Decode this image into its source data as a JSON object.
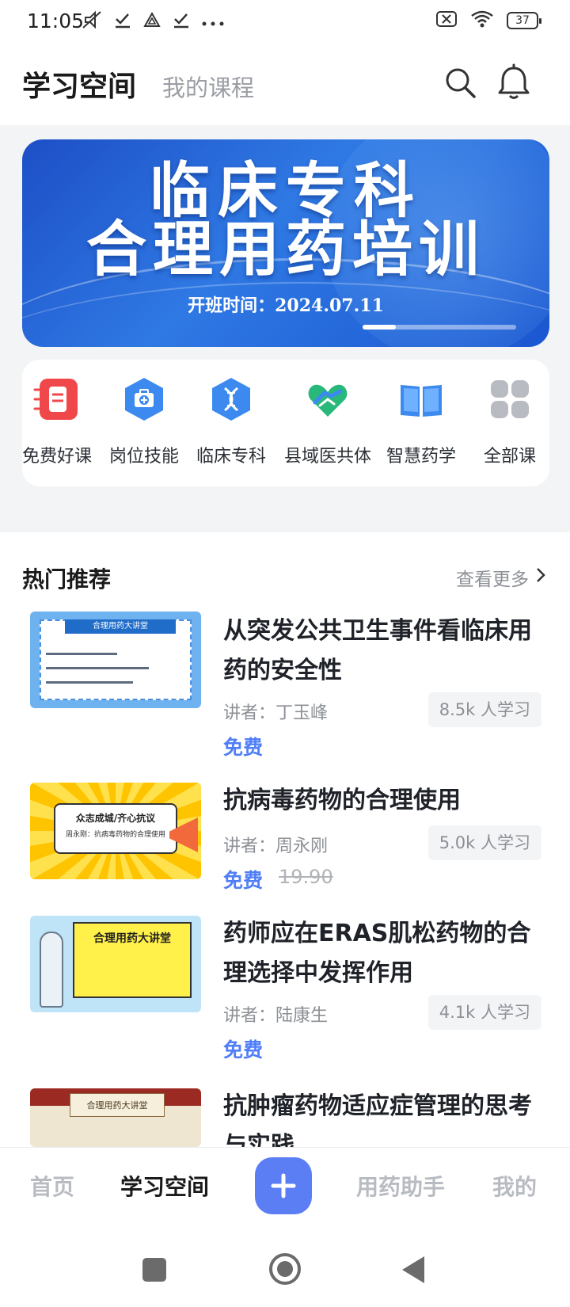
{
  "status_bar": {
    "time": "11:05",
    "left_icons": [
      "mute-icon",
      "check-icon",
      "cloud-icon",
      "check-icon",
      "more-dots-icon"
    ],
    "battery": "37",
    "right_icons": [
      "sim-off-icon",
      "wifi-icon",
      "battery-icon"
    ]
  },
  "header": {
    "title": "学习空间",
    "subtitle": "我的课程",
    "icons": [
      "search-icon",
      "bell-icon"
    ]
  },
  "banner": {
    "line1": "临床专科",
    "line2": "合理用药培训",
    "date_text": "开班时间：2024.07.11",
    "slide_index": 1,
    "slide_count": 5
  },
  "categories": [
    {
      "label": "免费好课",
      "icon": "free-course-icon",
      "color": "#f0484a"
    },
    {
      "label": "岗位技能",
      "icon": "medkit-icon",
      "color": "#3c8af0"
    },
    {
      "label": "临床专科",
      "icon": "dna-icon",
      "color": "#3c8af0"
    },
    {
      "label": "县域医共体",
      "icon": "handshake-heart-icon",
      "color": "#27b87a"
    },
    {
      "label": "智慧药学",
      "icon": "book-icon",
      "color": "#3c8af0"
    },
    {
      "label": "全部课",
      "icon": "grid-icon",
      "color": "#b8bbc1"
    }
  ],
  "hot": {
    "title": "热门推荐",
    "more": "查看更多"
  },
  "courses": [
    {
      "title": "从突发公共卫生事件看临床用药的安全性",
      "lecturer": "讲者：丁玉峰",
      "learners": "8.5k 人学习",
      "price": "免费",
      "original_price": "",
      "thumb_text": "合理用药大讲堂"
    },
    {
      "title": "抗病毒药物的合理使用",
      "lecturer": "讲者：周永刚",
      "learners": "5.0k 人学习",
      "price": "免费",
      "original_price": "19.90",
      "thumb_text": "众志成城/齐心抗议",
      "thumb_sub": "周永刚：抗病毒药物的合理使用"
    },
    {
      "title": "药师应在ERAS肌松药物的合理选择中发挥作用",
      "lecturer": "讲者：陆康生",
      "learners": "4.1k 人学习",
      "price": "免费",
      "original_price": "",
      "thumb_text": "合理用药大讲堂"
    },
    {
      "title": "抗肿瘤药物适应症管理的思考与实践",
      "lecturer": "",
      "learners": "",
      "price": "",
      "original_price": "",
      "thumb_text": "合理用药大讲堂"
    }
  ],
  "bottom_nav": {
    "items": [
      "首页",
      "学习空间",
      "用药助手",
      "我的"
    ],
    "active": "学习空间",
    "fab_icon": "plus-icon",
    "accent": "#5b7ef5"
  },
  "system_nav": [
    "recent-apps-icon",
    "home-icon",
    "back-icon"
  ]
}
